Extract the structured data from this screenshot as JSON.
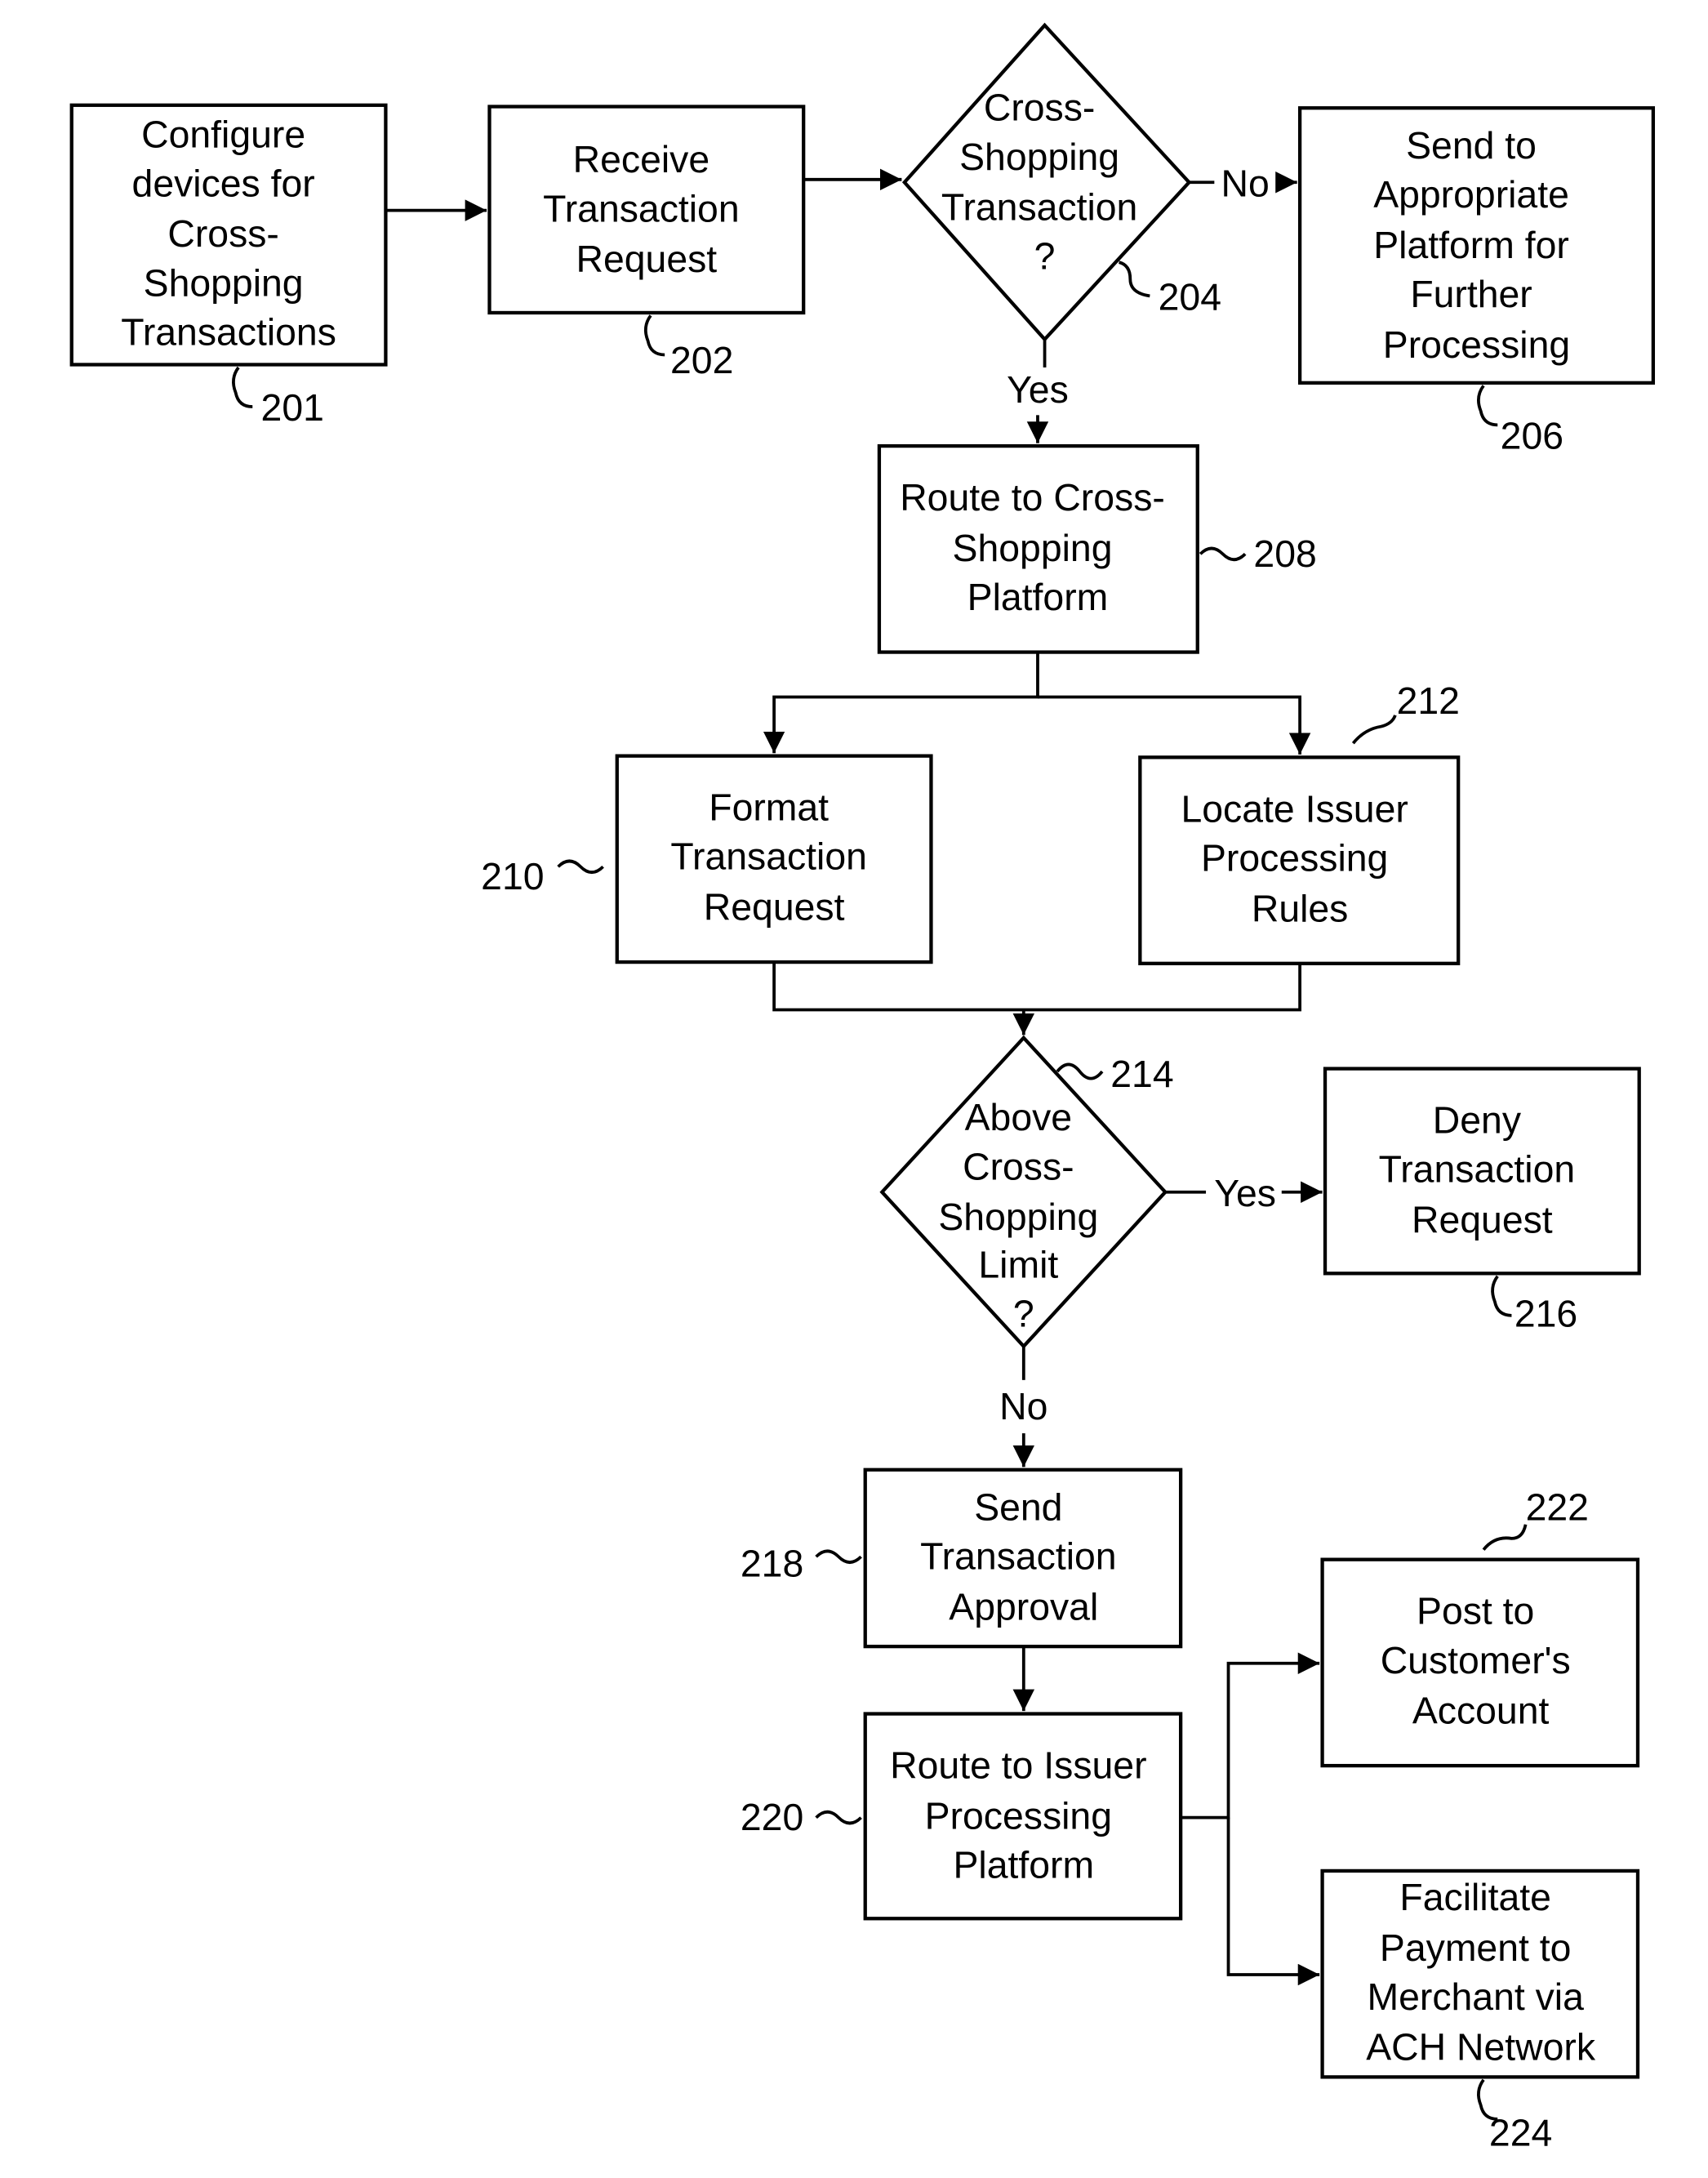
{
  "nodes": {
    "n201": {
      "ref": "201",
      "lines": [
        "Configure",
        "devices for",
        "Cross-",
        "Shopping",
        "Transactions"
      ]
    },
    "n202": {
      "ref": "202",
      "lines": [
        "Receive",
        "Transaction",
        "Request"
      ]
    },
    "n204": {
      "ref": "204",
      "lines": [
        "Cross-",
        "Shopping",
        "Transaction",
        "?"
      ]
    },
    "n206": {
      "ref": "206",
      "lines": [
        "Send to",
        "Appropriate",
        "Platform for",
        "Further",
        "Processing"
      ]
    },
    "n208": {
      "ref": "208",
      "lines": [
        "Route to Cross-",
        "Shopping",
        "Platform"
      ]
    },
    "n210": {
      "ref": "210",
      "lines": [
        "Format",
        "Transaction",
        "Request"
      ]
    },
    "n212": {
      "ref": "212",
      "lines": [
        "Locate Issuer",
        "Processing",
        "Rules"
      ]
    },
    "n214": {
      "ref": "214",
      "lines": [
        "Above",
        "Cross-",
        "Shopping",
        "Limit",
        "?"
      ]
    },
    "n216": {
      "ref": "216",
      "lines": [
        "Deny",
        "Transaction",
        "Request"
      ]
    },
    "n218": {
      "ref": "218",
      "lines": [
        "Send",
        "Transaction",
        "Approval"
      ]
    },
    "n220": {
      "ref": "220",
      "lines": [
        "Route to Issuer",
        "Processing",
        "Platform"
      ]
    },
    "n222": {
      "ref": "222",
      "lines": [
        "Post to",
        "Customer's",
        "Account"
      ]
    },
    "n224": {
      "ref": "224",
      "lines": [
        "Facilitate",
        "Payment to",
        "Merchant via",
        "ACH Network"
      ]
    }
  },
  "edge_labels": {
    "no_204": "No",
    "yes_204": "Yes",
    "yes_214": "Yes",
    "no_214": "No"
  }
}
